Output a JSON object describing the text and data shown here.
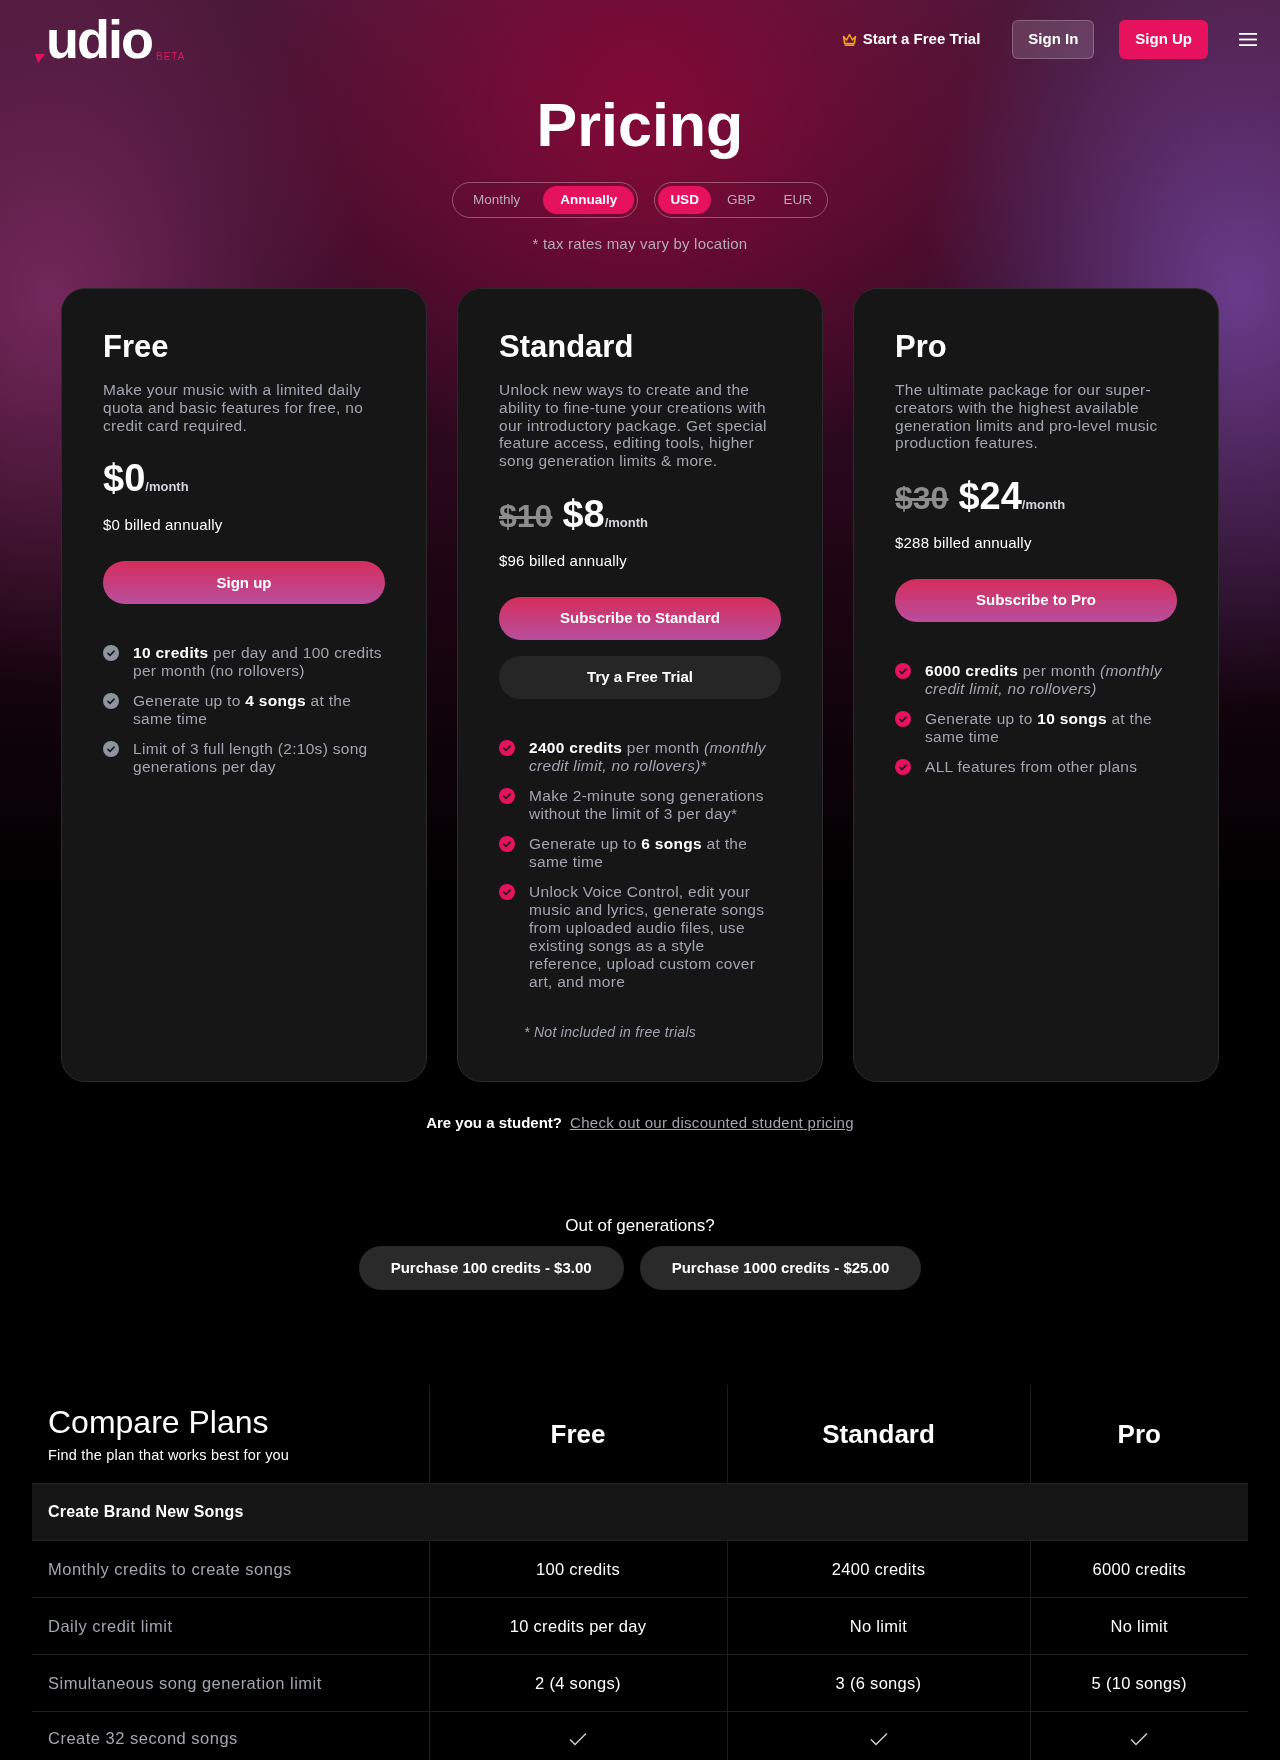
{
  "header": {
    "logo": "udio",
    "logo_badge": "BETA",
    "trial_link": "Start a Free Trial",
    "buttons": [
      {
        "label": "Sign In",
        "kind": "secondary"
      },
      {
        "label": "Sign Up",
        "kind": "primary"
      }
    ]
  },
  "hero": {
    "title": "Pricing",
    "billing_options": [
      {
        "label": "Monthly",
        "selected": false
      },
      {
        "label": "Annually",
        "selected": true
      }
    ],
    "currency_options": [
      {
        "label": "USD",
        "selected": true
      },
      {
        "label": "GBP",
        "selected": false
      },
      {
        "label": "EUR",
        "selected": false
      }
    ],
    "tax_note": "* tax rates may vary by location"
  },
  "plans": [
    {
      "name": "Free",
      "description": "Make your music with a limited daily quota and basic features for free, no credit card required.",
      "price": "$0",
      "period": "/month",
      "billing": "$0 billed annually",
      "color": "#8e939e",
      "buttons": [
        {
          "label": "Sign up",
          "kind": "primary"
        }
      ],
      "features": [
        {
          "text": "**10 credits** per day and 100 credits per month (no rollovers)"
        },
        {
          "text": "Generate up to **4 songs** at the same time"
        },
        {
          "text": "Limit of 3 full length (2:10s) song generations per day"
        }
      ]
    },
    {
      "name": "Standard",
      "description": "Unlock new ways to create and the ability to fine-tune your creations with our introductory package. Get special feature access, editing tools, higher song generation limits & more.",
      "old_price": "$10",
      "price": "$8",
      "period": "/month",
      "billing": "$96 billed annually",
      "color": "#e6125e",
      "buttons": [
        {
          "label": "Subscribe to Standard",
          "kind": "primary"
        },
        {
          "label": "Try a Free Trial",
          "kind": "secondary"
        }
      ],
      "features": [
        {
          "text": "**2400 credits** per month *(monthly credit limit, no rollovers)*",
          "mark": "*"
        },
        {
          "text": "Make 2-minute song generations without the limit of 3 per day",
          "mark": "*"
        },
        {
          "text": "Generate up to **6 songs** at the same time"
        },
        {
          "text": "Unlock Voice Control, edit your music and lyrics, generate songs from uploaded audio files, use existing songs as a style reference, upload custom cover art, and more"
        }
      ],
      "footnote": "* Not included in free trials"
    },
    {
      "name": "Pro",
      "description": "The ultimate package for our super-creators with the highest available generation limits and pro-level music production features.",
      "old_price": "$30",
      "price": "$24",
      "period": "/month",
      "billing": "$288 billed annually",
      "color": "#e6125e",
      "buttons": [
        {
          "label": "Subscribe to Pro",
          "kind": "primary"
        }
      ],
      "features": [
        {
          "text": "**6000 credits** per month *(monthly credit limit, no rollovers)*"
        },
        {
          "text": "Generate up to **10 songs** at the same time"
        },
        {
          "text": "ALL features from other plans"
        }
      ]
    }
  ],
  "student": {
    "question": "Are you a student?",
    "link": "Check out our discounted student pricing"
  },
  "top_up": {
    "title": "Out of generations?",
    "buttons": [
      "Purchase 100 credits - $3.00",
      "Purchase 1000 credits - $25.00"
    ]
  },
  "compare": {
    "title": "Compare Plans",
    "subtitle": "Find the plan that works best for you",
    "columns": [
      "Free",
      "Standard",
      "Pro"
    ],
    "sections": [
      {
        "title": "Create Brand New Songs",
        "rows": [
          {
            "label": "Monthly credits to create songs",
            "cells": [
              {
                "kind": "text",
                "text": "100 credits"
              },
              {
                "kind": "text",
                "text": "2400 credits"
              },
              {
                "kind": "text",
                "text": "6000 credits"
              }
            ]
          },
          {
            "label": "Daily credit limit",
            "cells": [
              {
                "kind": "text",
                "text": "10 credits per day"
              },
              {
                "kind": "text",
                "text": "No limit"
              },
              {
                "kind": "text",
                "text": "No limit"
              }
            ]
          },
          {
            "label": "Simultaneous song generation limit",
            "cells": [
              {
                "kind": "text",
                "text": "2 (4 songs)"
              },
              {
                "kind": "text",
                "text": "3 (6 songs)"
              },
              {
                "kind": "text",
                "text": "5 (10 songs)"
              }
            ]
          },
          {
            "label": "Create 32 second songs",
            "cells": [
              {
                "kind": "check"
              },
              {
                "kind": "check"
              },
              {
                "kind": "check"
              }
            ]
          }
        ]
      }
    ]
  }
}
